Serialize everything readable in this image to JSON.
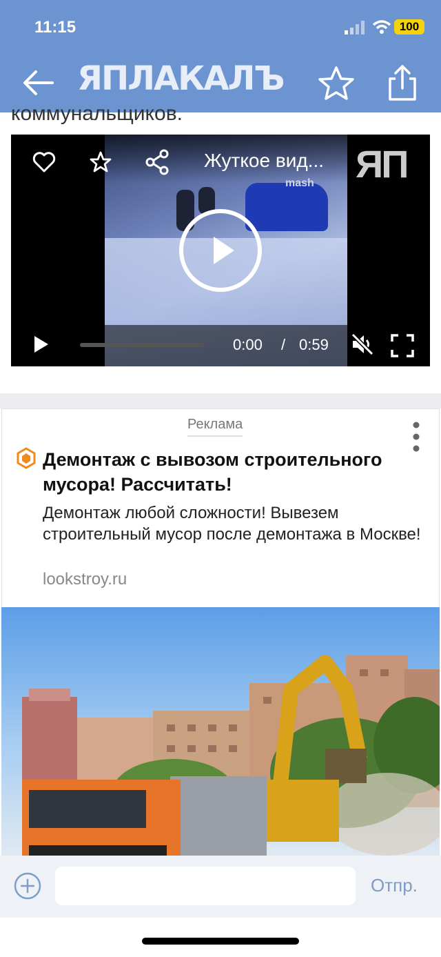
{
  "status_bar": {
    "time": "11:15",
    "battery": "100"
  },
  "nav": {
    "logo_text": "ЯПЛАКАЛЪ"
  },
  "article": {
    "text_fragment": "коммунальщиков."
  },
  "video": {
    "title": "Жуткое вид...",
    "brand": "ЯП",
    "watermark": "mash",
    "current_time": "0:00",
    "separator": "/",
    "duration": "0:59"
  },
  "ad": {
    "label": "Реклама",
    "title": "Демонтаж с вывозом строительного мусора! Рассчитать!",
    "description": "Демонтаж любой сложности! Вывезем строительный мусор после демонтажа в Москве!",
    "domain": "lookstroy.ru"
  },
  "composer": {
    "input_value": "",
    "send_label": "Отпр."
  },
  "colors": {
    "nav_bg": "#6b94d0",
    "battery": "#f5d20a",
    "send": "#7d9cc9"
  }
}
